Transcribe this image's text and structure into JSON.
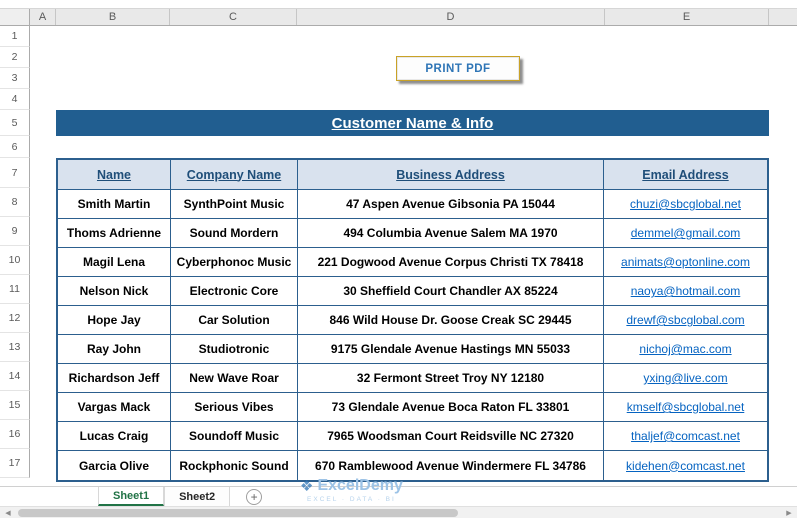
{
  "colors": {
    "title_bg": "#215E90",
    "table_border": "#2C5F8E",
    "header_row_bg": "#D9E2EE",
    "header_text": "#1F4E79",
    "email_link": "#0563C1",
    "button_text": "#2E75B6",
    "button_border": "#C9A227",
    "active_tab_green": "#217346",
    "watermark_blue": "#9DC3E6"
  },
  "sheet": {
    "column_letters": [
      "A",
      "B",
      "C",
      "D",
      "E"
    ],
    "row_numbers": [
      1,
      2,
      3,
      4,
      5,
      6,
      7,
      8,
      9,
      10,
      11,
      12,
      13,
      14,
      15,
      16,
      17
    ]
  },
  "toolbar": {
    "print_button_label": "PRINT PDF"
  },
  "title": "Customer Name & Info",
  "table": {
    "headers": [
      "Name",
      "Company Name",
      "Business Address",
      "Email Address"
    ],
    "rows": [
      {
        "name": "Smith Martin",
        "company": "SynthPoint Music",
        "address": "47 Aspen Avenue Gibsonia PA 15044",
        "email": "chuzi@sbcglobal.net"
      },
      {
        "name": "Thoms Adrienne",
        "company": "Sound Mordern",
        "address": "494 Columbia Avenue Salem MA 1970",
        "email": "demmel@gmail.com"
      },
      {
        "name": "Magil Lena",
        "company": "Cyberphonoc Music",
        "address": "221 Dogwood Avenue Corpus Christi TX 78418",
        "email": "animats@optonline.com"
      },
      {
        "name": "Nelson Nick",
        "company": "Electronic Core",
        "address": "30 Sheffield Court Chandler AX 85224",
        "email": "naoya@hotmail.com"
      },
      {
        "name": "Hope Jay",
        "company": "Car Solution",
        "address": "846 Wild House Dr. Goose Creak SC 29445",
        "email": "drewf@sbcglobal.com"
      },
      {
        "name": "Ray John",
        "company": "Studiotronic",
        "address": "9175 Glendale Avenue Hastings MN 55033",
        "email": "nichoj@mac.com"
      },
      {
        "name": "Richardson Jeff",
        "company": "New Wave Roar",
        "address": "32 Fermont Street Troy NY 12180",
        "email": "yxing@live.com"
      },
      {
        "name": "Vargas Mack",
        "company": "Serious Vibes",
        "address": "73 Glendale Avenue Boca Raton FL 33801",
        "email": "kmself@sbcglobal.net"
      },
      {
        "name": "Lucas Craig",
        "company": "Soundoff Music",
        "address": "7965 Woodsman Court Reidsville NC 27320",
        "email": "thaljef@comcast.net"
      },
      {
        "name": "Garcia Olive",
        "company": "Rockphonic Sound",
        "address": "670 Ramblewood Avenue Windermere FL 34786",
        "email": "kidehen@comcast.net"
      }
    ]
  },
  "sheet_tabs": {
    "active_label": "Sheet1",
    "inactive_label": "Sheet2",
    "add_label": "+"
  },
  "scrollbar": {
    "left_arrow": "◀",
    "right_arrow": "▶"
  },
  "watermark": {
    "logo_glyph": "❖",
    "brand": "ExcelDemy",
    "tagline": "EXCEL · DATA · BI"
  }
}
